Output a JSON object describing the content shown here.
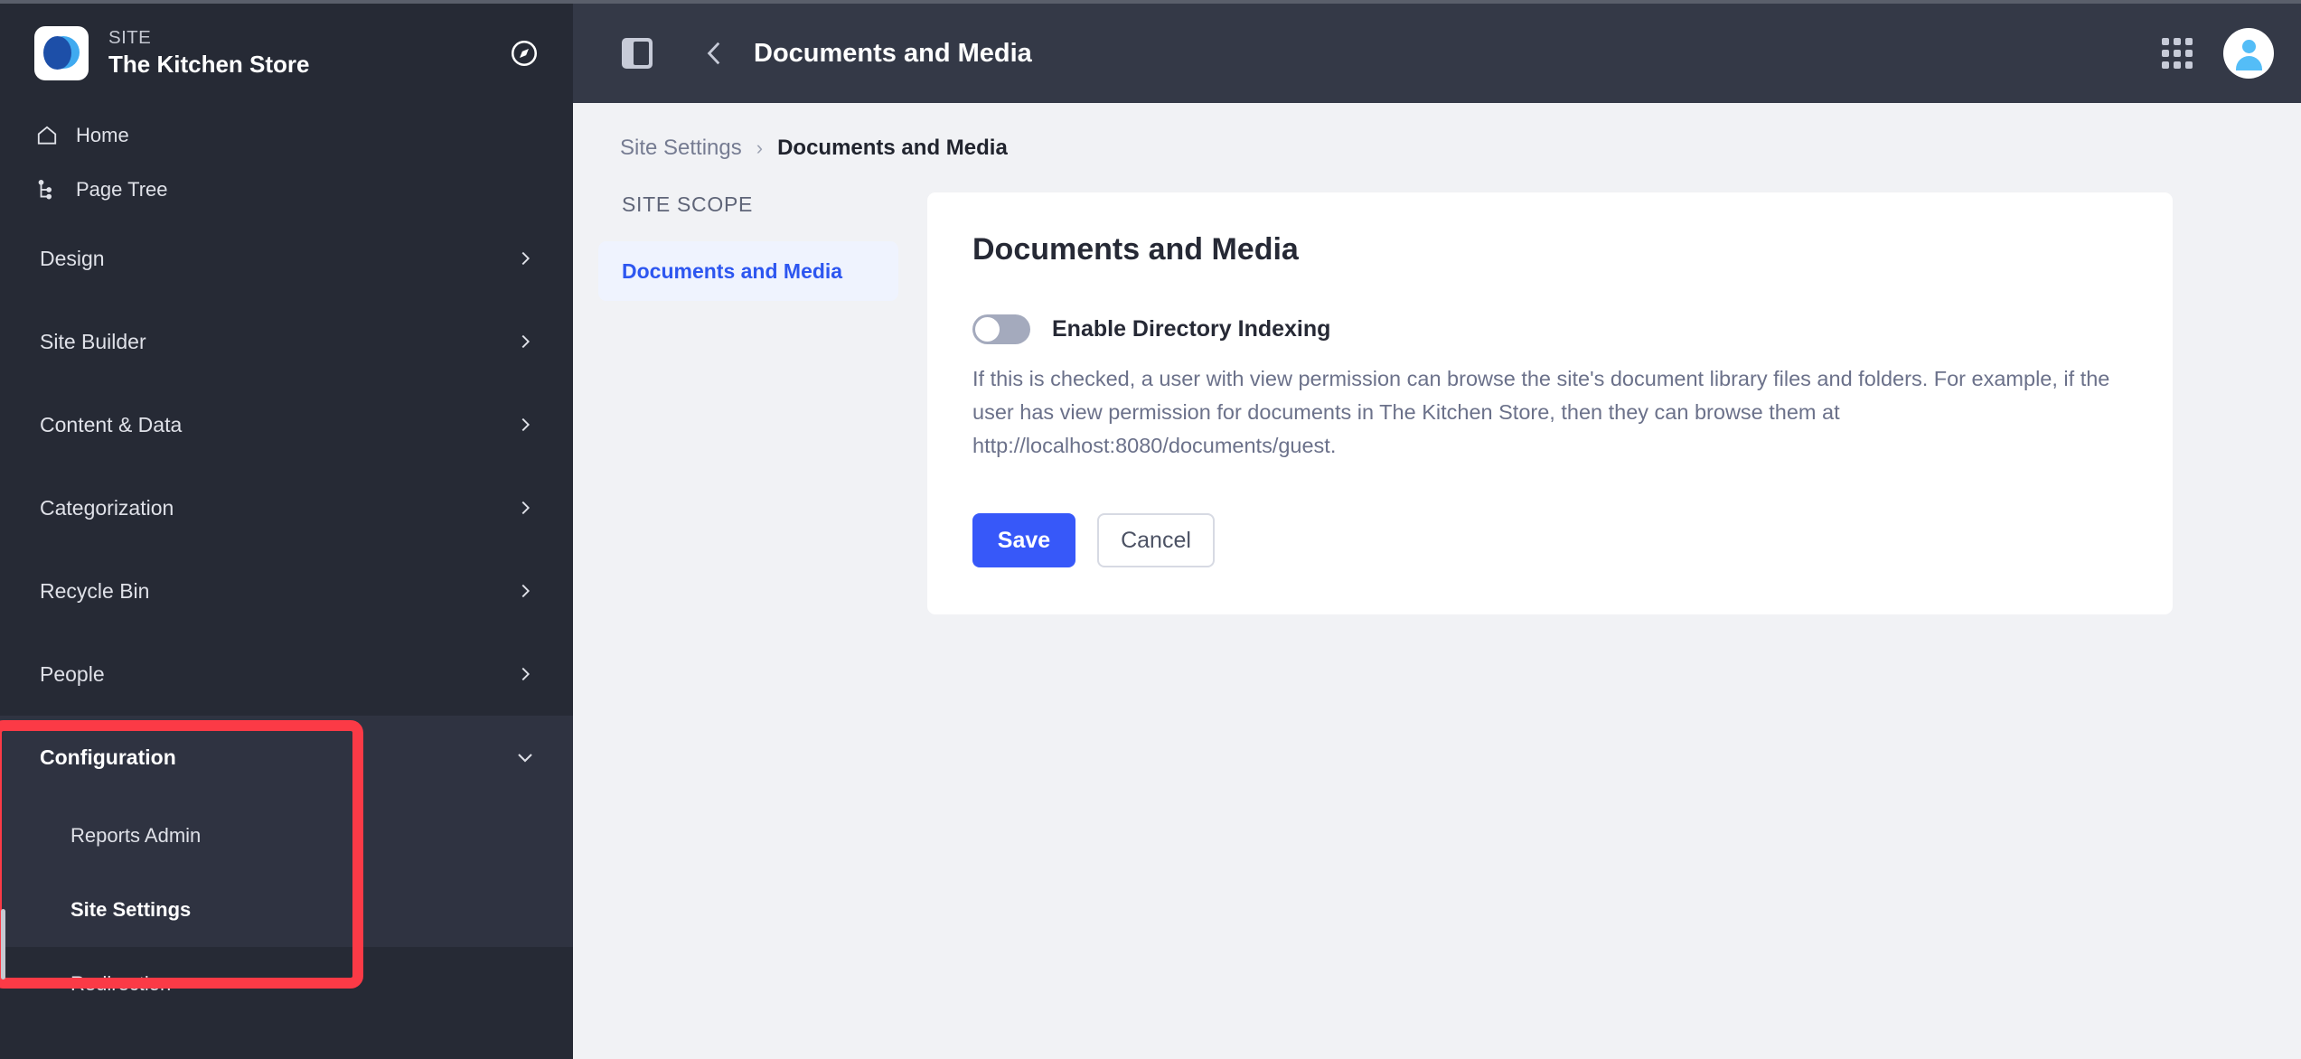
{
  "sidebar": {
    "brand": {
      "kicker": "SITE",
      "title": "The Kitchen Store",
      "compass_icon": "compass-icon"
    },
    "quick_items": [
      {
        "label": "Home",
        "icon": "home-icon"
      },
      {
        "label": "Page Tree",
        "icon": "page-tree-icon"
      }
    ],
    "groups": [
      {
        "label": "Design",
        "expanded": false
      },
      {
        "label": "Site Builder",
        "expanded": false
      },
      {
        "label": "Content & Data",
        "expanded": false
      },
      {
        "label": "Categorization",
        "expanded": false
      },
      {
        "label": "Recycle Bin",
        "expanded": false
      },
      {
        "label": "People",
        "expanded": false
      },
      {
        "label": "Configuration",
        "expanded": true
      }
    ],
    "configuration_children": [
      {
        "label": "Reports Admin",
        "active": false
      },
      {
        "label": "Site Settings",
        "active": true
      }
    ],
    "after_configuration": [
      {
        "label": "Redirection"
      }
    ],
    "highlight_color": "#fb3a46"
  },
  "topbar": {
    "panel_toggle_icon": "sidebar-panel-icon",
    "back_icon": "chevron-left-icon",
    "title": "Documents and Media",
    "apps_icon": "apps-grid-icon",
    "avatar_icon": "user-avatar-icon"
  },
  "breadcrumb": {
    "parent": "Site Settings",
    "separator": "›",
    "current": "Documents and Media"
  },
  "scope": {
    "header": "SITE SCOPE",
    "items": [
      {
        "label": "Documents and Media",
        "active": true
      }
    ],
    "active_bg": "#eff3fe",
    "active_color": "#2d56f0"
  },
  "card": {
    "title": "Documents and Media",
    "toggle": {
      "label": "Enable Directory Indexing",
      "state": "off",
      "track_color": "#a4aabd"
    },
    "help_text": "If this is checked, a user with view permission can browse the site's document library files and folders. For example, if the user has view permission for documents in The Kitchen Store, then they can browse them at http://localhost:8080/documents/guest.",
    "buttons": {
      "save": "Save",
      "cancel": "Cancel",
      "save_color": "#3758f9"
    }
  }
}
